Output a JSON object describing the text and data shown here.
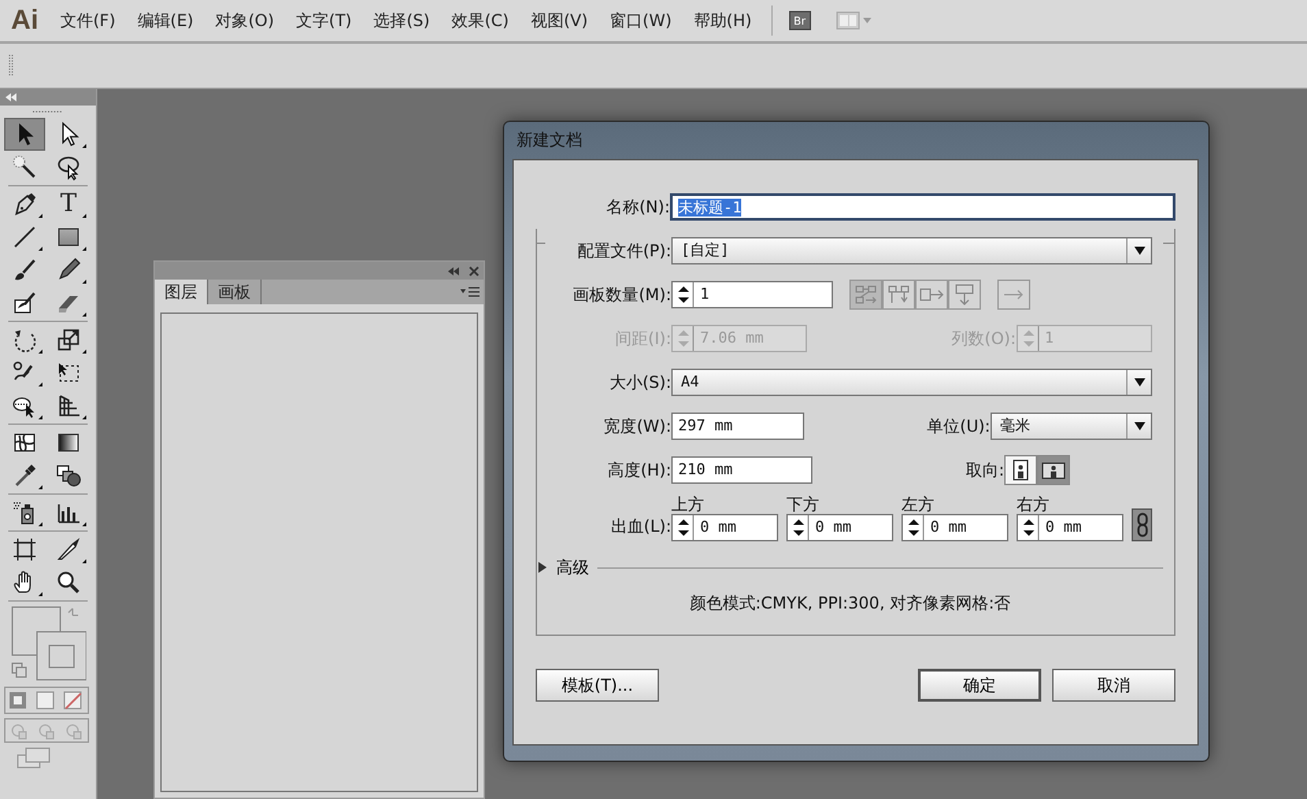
{
  "app": {
    "logo": "Ai",
    "menus": [
      "文件(F)",
      "编辑(E)",
      "对象(O)",
      "文字(T)",
      "选择(S)",
      "效果(C)",
      "视图(V)",
      "窗口(W)",
      "帮助(H)"
    ],
    "bridge_button": "Br"
  },
  "toolbox": {
    "groups": [
      {
        "tools": [
          {
            "kind": "selection",
            "selected": true,
            "flyout": false
          },
          {
            "kind": "direct-selection",
            "selected": false,
            "flyout": true
          },
          {
            "kind": "magic-wand",
            "selected": false,
            "flyout": false
          },
          {
            "kind": "lasso",
            "selected": false,
            "flyout": false
          }
        ]
      },
      {
        "tools": [
          {
            "kind": "pen",
            "selected": false,
            "flyout": true
          },
          {
            "kind": "type",
            "glyph": "T",
            "selected": false,
            "flyout": true
          },
          {
            "kind": "line",
            "selected": false,
            "flyout": true
          },
          {
            "kind": "rectangle",
            "selected": false,
            "flyout": true
          },
          {
            "kind": "paintbrush",
            "selected": false,
            "flyout": false
          },
          {
            "kind": "pencil",
            "selected": false,
            "flyout": true
          },
          {
            "kind": "blob-brush",
            "selected": false,
            "flyout": false
          },
          {
            "kind": "eraser",
            "selected": false,
            "flyout": true
          }
        ]
      },
      {
        "tools": [
          {
            "kind": "rotate",
            "selected": false,
            "flyout": true
          },
          {
            "kind": "scale",
            "selected": false,
            "flyout": true
          },
          {
            "kind": "warp",
            "selected": false,
            "flyout": true
          },
          {
            "kind": "free-transform",
            "selected": false,
            "flyout": false
          },
          {
            "kind": "shape-builder",
            "selected": false,
            "flyout": true
          },
          {
            "kind": "perspective-grid",
            "selected": false,
            "flyout": true
          }
        ]
      },
      {
        "tools": [
          {
            "kind": "mesh",
            "selected": false,
            "flyout": false
          },
          {
            "kind": "gradient",
            "selected": false,
            "flyout": false
          },
          {
            "kind": "eyedropper",
            "selected": false,
            "flyout": true
          },
          {
            "kind": "blend",
            "selected": false,
            "flyout": false
          }
        ]
      },
      {
        "tools": [
          {
            "kind": "symbol-sprayer",
            "selected": false,
            "flyout": true
          },
          {
            "kind": "graph",
            "selected": false,
            "flyout": true
          }
        ]
      },
      {
        "tools": [
          {
            "kind": "artboard",
            "selected": false,
            "flyout": false
          },
          {
            "kind": "slice",
            "selected": false,
            "flyout": true
          },
          {
            "kind": "hand",
            "selected": false,
            "flyout": true
          },
          {
            "kind": "zoom",
            "selected": false,
            "flyout": false
          }
        ]
      }
    ]
  },
  "layers_panel": {
    "tabs": [
      {
        "label": "图层",
        "selected": true
      },
      {
        "label": "画板",
        "selected": false
      }
    ]
  },
  "dialog": {
    "title": "新建文档",
    "name": {
      "label": "名称(N):",
      "value": "未标题-1",
      "text_selected": true
    },
    "profile": {
      "label": "配置文件(P):",
      "value": "[自定]"
    },
    "artboards": {
      "label": "画板数量(M):",
      "value": "1",
      "layouts": [
        {
          "kind": "grid-by-row",
          "selected": true
        },
        {
          "kind": "grid-by-column",
          "selected": false
        },
        {
          "kind": "arrange-by-row",
          "selected": false
        },
        {
          "kind": "arrange-by-column",
          "selected": false
        },
        {
          "kind": "right-to-left",
          "selected": false
        }
      ]
    },
    "spacing": {
      "label": "间距(I):",
      "value": "7.06 mm",
      "disabled": true
    },
    "columns": {
      "label": "列数(O):",
      "value": "1",
      "disabled": true
    },
    "size": {
      "label": "大小(S):",
      "value": "A4"
    },
    "width": {
      "label": "宽度(W):",
      "value": "297 mm"
    },
    "units": {
      "label": "单位(U):",
      "value": "毫米"
    },
    "height": {
      "label": "高度(H):",
      "value": "210 mm"
    },
    "orientation": {
      "label": "取向:",
      "options": [
        {
          "kind": "portrait",
          "selected": false
        },
        {
          "kind": "landscape",
          "selected": true
        }
      ]
    },
    "bleed": {
      "label": "出血(L):",
      "linked": true,
      "fields": [
        {
          "caption": "上方",
          "value": "0 mm"
        },
        {
          "caption": "下方",
          "value": "0 mm"
        },
        {
          "caption": "左方",
          "value": "0 mm"
        },
        {
          "caption": "右方",
          "value": "0 mm"
        }
      ]
    },
    "advanced": {
      "label": "高级",
      "expanded": false
    },
    "summary": "颜色模式:CMYK, PPI:300, 对齐像素网格:否",
    "buttons": [
      {
        "label": "模板(T)...",
        "kind": "template"
      },
      {
        "label": "确定",
        "kind": "default"
      },
      {
        "label": "取消",
        "kind": "cancel"
      }
    ]
  }
}
